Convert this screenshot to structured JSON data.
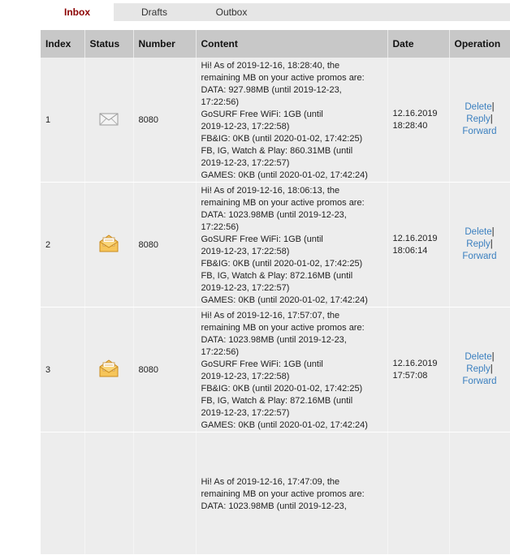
{
  "tabs": {
    "inbox": "Inbox",
    "drafts": "Drafts",
    "outbox": "Outbox"
  },
  "columns": {
    "index": "Index",
    "status": "Status",
    "number": "Number",
    "content": "Content",
    "date": "Date",
    "operation": "Operation"
  },
  "operations": {
    "delete": "Delete",
    "sep": "|",
    "reply": "Reply",
    "forward": "Forward"
  },
  "messages": [
    {
      "index": "1",
      "status": "read-envelope-icon",
      "number": "8080",
      "content": [
        "Hi! As of 2019-12-16, 18:28:40, the",
        "remaining MB on your active promos are:",
        "DATA: 927.98MB (until 2019-12-23,",
        "17:22:56)",
        "GoSURF Free WiFi: 1GB (until",
        "2019-12-23, 17:22:58)",
        "FB&IG: 0KB (until 2020-01-02, 17:42:25)",
        "FB, IG, Watch & Play: 860.31MB (until",
        "2019-12-23, 17:22:57)",
        "GAMES: 0KB (until 2020-01-02, 17:42:24)"
      ],
      "date": "12.16.2019",
      "time": "18:28:40"
    },
    {
      "index": "2",
      "status": "unread-envelope-icon",
      "number": "8080",
      "content": [
        "Hi! As of 2019-12-16, 18:06:13, the",
        "remaining MB on your active promos are:",
        "DATA: 1023.98MB (until 2019-12-23,",
        "17:22:56)",
        "GoSURF Free WiFi: 1GB (until",
        "2019-12-23, 17:22:58)",
        "FB&IG: 0KB (until 2020-01-02, 17:42:25)",
        "FB, IG, Watch & Play: 872.16MB (until",
        "2019-12-23, 17:22:57)",
        "GAMES: 0KB (until 2020-01-02, 17:42:24)"
      ],
      "date": "12.16.2019",
      "time": "18:06:14"
    },
    {
      "index": "3",
      "status": "unread-envelope-icon",
      "number": "8080",
      "content": [
        "Hi! As of 2019-12-16, 17:57:07, the",
        "remaining MB on your active promos are:",
        "DATA: 1023.98MB (until 2019-12-23,",
        "17:22:56)",
        "GoSURF Free WiFi: 1GB (until",
        "2019-12-23, 17:22:58)",
        "FB&IG: 0KB (until 2020-01-02, 17:42:25)",
        "FB, IG, Watch & Play: 872.16MB (until",
        "2019-12-23, 17:22:57)",
        "GAMES: 0KB (until 2020-01-02, 17:42:24)"
      ],
      "date": "12.16.2019",
      "time": "17:57:08"
    },
    {
      "index": "",
      "status": "",
      "number": "",
      "content": [
        "Hi! As of 2019-12-16, 17:47:09, the",
        "remaining MB on your active promos are:",
        "DATA: 1023.98MB (until 2019-12-23,"
      ],
      "date": "",
      "time": ""
    }
  ]
}
